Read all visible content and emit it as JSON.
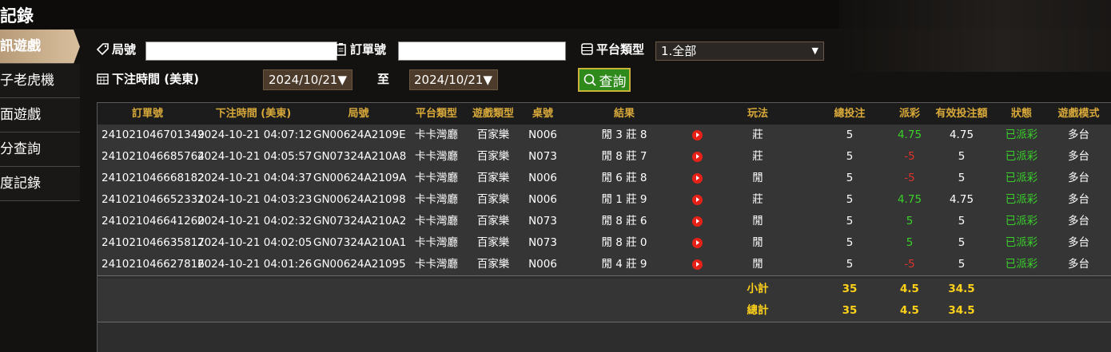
{
  "header": {
    "title": "記錄"
  },
  "sidebar": {
    "items": [
      {
        "label": "訊遊戲",
        "active": true
      },
      {
        "label": "子老虎機",
        "active": false
      },
      {
        "label": "面遊戲",
        "active": false
      },
      {
        "label": "分查詢",
        "active": false
      },
      {
        "label": "度記錄",
        "active": false
      }
    ]
  },
  "filters": {
    "round_label": "局號",
    "round_value": "",
    "order_label": "訂單號",
    "order_value": "",
    "platform_label": "平台類型",
    "platform_selected": "1.全部",
    "time_label": "下注時間 (美東)",
    "date_from": "2024/10/21",
    "date_to_label": "至",
    "date_to": "2024/10/21",
    "query_label": "查詢"
  },
  "table": {
    "columns": [
      "訂單號",
      "下注時間 (美東)",
      "局號",
      "平台類型",
      "遊戲類型",
      "桌號",
      "結果",
      "",
      "玩法",
      "總投注",
      "派彩",
      "有效投注額",
      "狀態",
      "遊戲模式"
    ],
    "rows": [
      {
        "order": "241021046701349",
        "time": "2024-10-21 04:07:12",
        "round": "GN00624A2109E",
        "platform": "卡卡灣廳",
        "game": "百家樂",
        "table": "N006",
        "result": "閒 3 莊 8",
        "play": "莊",
        "bet": "5",
        "payout": "4.75",
        "payout_color": "green",
        "valid": "4.75",
        "status": "已派彩",
        "mode": "多台"
      },
      {
        "order": "241021046685764",
        "time": "2024-10-21 04:05:57",
        "round": "GN07324A210A8",
        "platform": "卡卡灣廳",
        "game": "百家樂",
        "table": "N073",
        "result": "閒 8 莊 7",
        "play": "莊",
        "bet": "5",
        "payout": "-5",
        "payout_color": "red",
        "valid": "5",
        "status": "已派彩",
        "mode": "多台"
      },
      {
        "order": "241021046668182",
        "time": "2024-10-21 04:04:37",
        "round": "GN00624A2109A",
        "platform": "卡卡灣廳",
        "game": "百家樂",
        "table": "N006",
        "result": "閒 6 莊 8",
        "play": "閒",
        "bet": "5",
        "payout": "-5",
        "payout_color": "red",
        "valid": "5",
        "status": "已派彩",
        "mode": "多台"
      },
      {
        "order": "241021046652331",
        "time": "2024-10-21 04:03:23",
        "round": "GN00624A21098",
        "platform": "卡卡灣廳",
        "game": "百家樂",
        "table": "N006",
        "result": "閒 1 莊 9",
        "play": "莊",
        "bet": "5",
        "payout": "4.75",
        "payout_color": "green",
        "valid": "4.75",
        "status": "已派彩",
        "mode": "多台"
      },
      {
        "order": "241021046641260",
        "time": "2024-10-21 04:02:32",
        "round": "GN07324A210A2",
        "platform": "卡卡灣廳",
        "game": "百家樂",
        "table": "N073",
        "result": "閒 8 莊 6",
        "play": "閒",
        "bet": "5",
        "payout": "5",
        "payout_color": "green",
        "valid": "5",
        "status": "已派彩",
        "mode": "多台"
      },
      {
        "order": "241021046635817",
        "time": "2024-10-21 04:02:05",
        "round": "GN07324A210A1",
        "platform": "卡卡灣廳",
        "game": "百家樂",
        "table": "N073",
        "result": "閒 8 莊 0",
        "play": "閒",
        "bet": "5",
        "payout": "5",
        "payout_color": "green",
        "valid": "5",
        "status": "已派彩",
        "mode": "多台"
      },
      {
        "order": "241021046627816",
        "time": "2024-10-21 04:01:26",
        "round": "GN00624A21095",
        "platform": "卡卡灣廳",
        "game": "百家樂",
        "table": "N006",
        "result": "閒 4 莊 9",
        "play": "閒",
        "bet": "5",
        "payout": "-5",
        "payout_color": "red",
        "valid": "5",
        "status": "已派彩",
        "mode": "多台"
      }
    ],
    "subtotal": {
      "label": "小計",
      "bet": "35",
      "payout": "4.5",
      "valid": "34.5"
    },
    "total": {
      "label": "總計",
      "bet": "35",
      "payout": "4.5",
      "valid": "34.5"
    }
  },
  "colors": {
    "green": "#39d12a",
    "red": "#e0332b",
    "gold": "#d9a93a",
    "accent": "#ffd21a"
  },
  "icons": {
    "round": "tag-icon",
    "order": "clipboard-icon",
    "platform": "list-icon",
    "time": "calendar-icon",
    "query": "search-icon",
    "video": "play-icon"
  }
}
